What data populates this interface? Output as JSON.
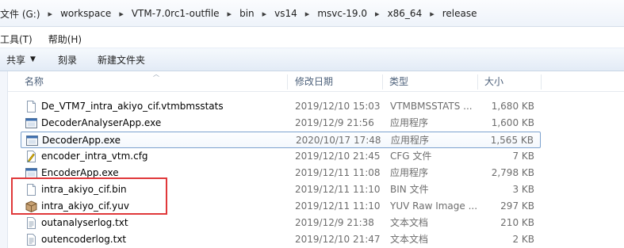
{
  "address": {
    "crumbs": [
      "文件 (G:)",
      "workspace",
      "VTM-7.0rc1-outfile",
      "bin",
      "vs14",
      "msvc-19.0",
      "x86_64",
      "release"
    ]
  },
  "menu": {
    "items": [
      "工具(T)",
      "帮助(H)"
    ]
  },
  "toolbar": {
    "share_label": "共享",
    "burn_label": "刻录",
    "new_folder_label": "新建文件夹"
  },
  "columns": {
    "name": "名称",
    "date": "修改日期",
    "type": "类型",
    "size": "大小"
  },
  "files": [
    {
      "name": "De_VTM7_intra_akiyo_cif.vtmbmsstats",
      "date": "2019/12/10 15:03",
      "type": "VTMBMSSTATS ...",
      "size": "1,680 KB",
      "icon": "generic-file-icon"
    },
    {
      "name": "DecoderAnalyserApp.exe",
      "date": "2019/12/9 21:56",
      "type": "应用程序",
      "size": "1,600 KB",
      "icon": "exe-icon"
    },
    {
      "name": "DecoderApp.exe",
      "date": "2020/10/17 17:48",
      "type": "应用程序",
      "size": "1,565 KB",
      "icon": "exe-icon"
    },
    {
      "name": "encoder_intra_vtm.cfg",
      "date": "2019/12/10 21:45",
      "type": "CFG 文件",
      "size": "7 KB",
      "icon": "cfg-file-icon"
    },
    {
      "name": "EncoderApp.exe",
      "date": "2019/12/11 11:08",
      "type": "应用程序",
      "size": "2,798 KB",
      "icon": "exe-icon"
    },
    {
      "name": "intra_akiyo_cif.bin",
      "date": "2019/12/11 11:10",
      "type": "BIN 文件",
      "size": "3 KB",
      "icon": "generic-file-icon"
    },
    {
      "name": "intra_akiyo_cif.yuv",
      "date": "2019/12/11 11:10",
      "type": "YUV Raw Image ...",
      "size": "297 KB",
      "icon": "yuv-file-icon"
    },
    {
      "name": "outanalyserlog.txt",
      "date": "2019/12/9 21:38",
      "type": "文本文档",
      "size": "210 KB",
      "icon": "text-file-icon"
    },
    {
      "name": "outencoderlog.txt",
      "date": "2019/12/10 21:47",
      "type": "文本文档",
      "size": "2 KB",
      "icon": "text-file-icon"
    }
  ],
  "selected_index": 2,
  "colors": {
    "highlight": "#e0383a",
    "selection_border": "#7da2ce"
  }
}
